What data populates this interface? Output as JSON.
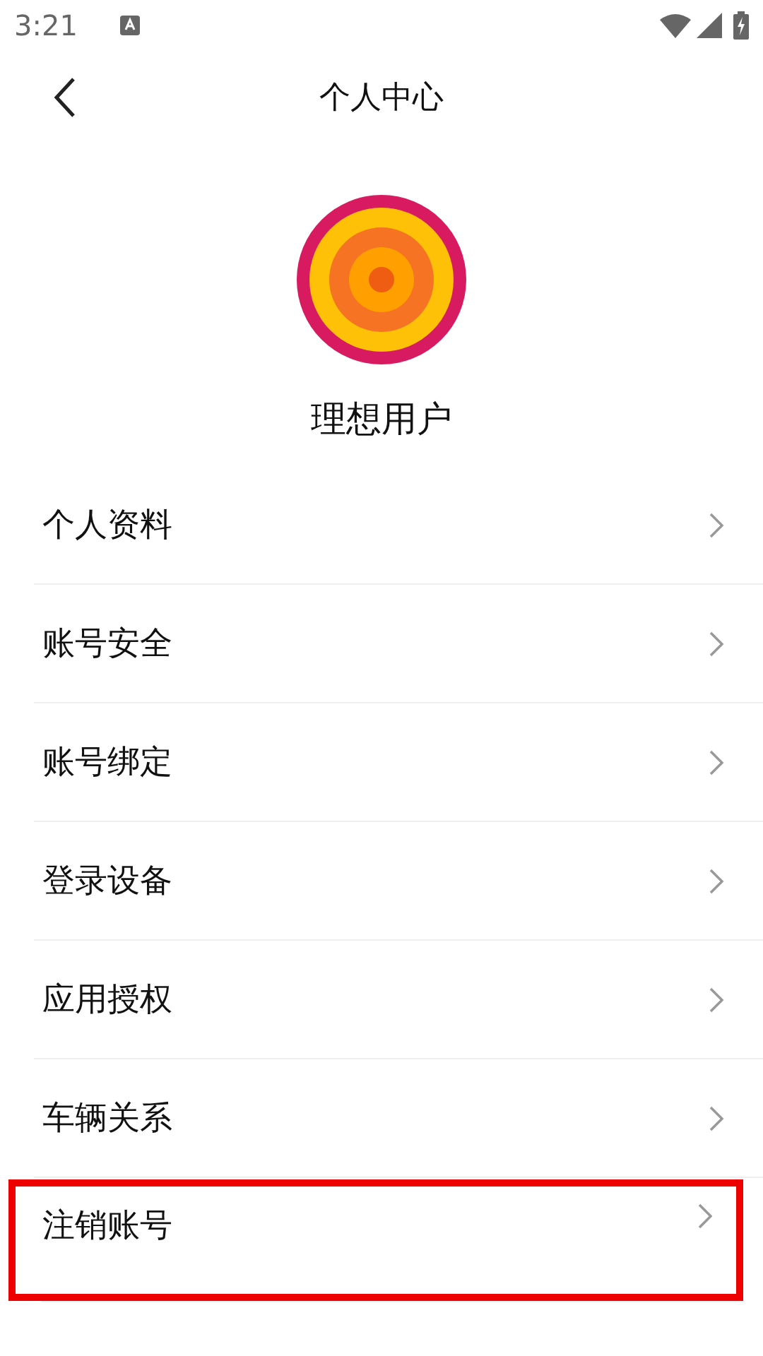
{
  "status_bar": {
    "time": "3:21"
  },
  "header": {
    "title": "个人中心"
  },
  "profile": {
    "name": "理想用户"
  },
  "menu": [
    {
      "label": "个人资料",
      "highlighted": false
    },
    {
      "label": "账号安全",
      "highlighted": false
    },
    {
      "label": "账号绑定",
      "highlighted": false
    },
    {
      "label": "登录设备",
      "highlighted": false
    },
    {
      "label": "应用授权",
      "highlighted": false
    },
    {
      "label": "车辆关系",
      "highlighted": false
    },
    {
      "label": "注销账号",
      "highlighted": true
    }
  ]
}
